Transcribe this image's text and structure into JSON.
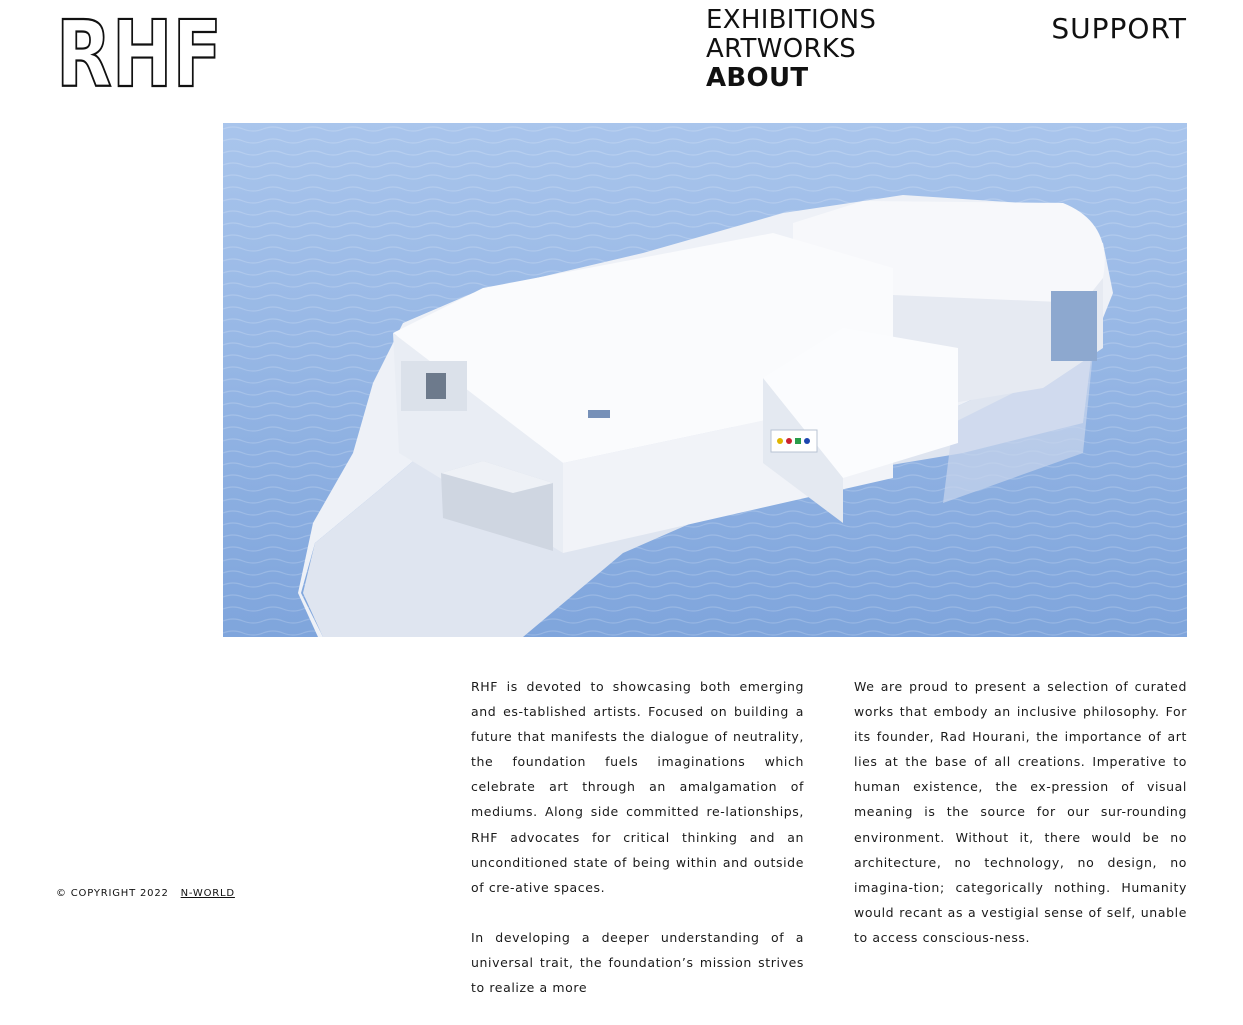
{
  "brand": {
    "logo_text": "RHF"
  },
  "nav": {
    "items": [
      {
        "label": "EXHIBITIONS",
        "active": false
      },
      {
        "label": "ARTWORKS",
        "active": false
      },
      {
        "label": "ABOUT",
        "active": true
      }
    ],
    "support": "SUPPORT"
  },
  "hero": {
    "image": "white-building-on-ice-floe-in-water"
  },
  "about": {
    "left": [
      "RHF is devoted to showcasing both emerging and es-tablished artists. Focused on building a future that manifests the dialogue of neutrality, the foundation fuels imaginations which celebrate art through an amalgamation of mediums. Along side committed re-lationships, RHF advocates for critical thinking and an unconditioned state of being within and outside of cre-ative spaces.",
      "In developing a deeper understanding of a universal trait, the foundation’s mission strives to realize a more"
    ],
    "right": [
      "We are proud to present a selection of curated works that embody an inclusive philosophy. For its founder, Rad Hourani, the importance of art lies at the base of all creations. Imperative to human existence, the ex-pression of visual meaning is the source for our sur-rounding environment. Without it, there would be no architecture, no technology, no design, no imagina-tion; categorically nothing. Humanity would recant as a vestigial sense of self, unable to access conscious-ness."
    ]
  },
  "footer": {
    "copyright": "© COPYRIGHT 2022",
    "link": "N-WORLD"
  },
  "colors": {
    "water": "#8fb2e2",
    "building": "#f2f4f8",
    "text": "#111111"
  }
}
